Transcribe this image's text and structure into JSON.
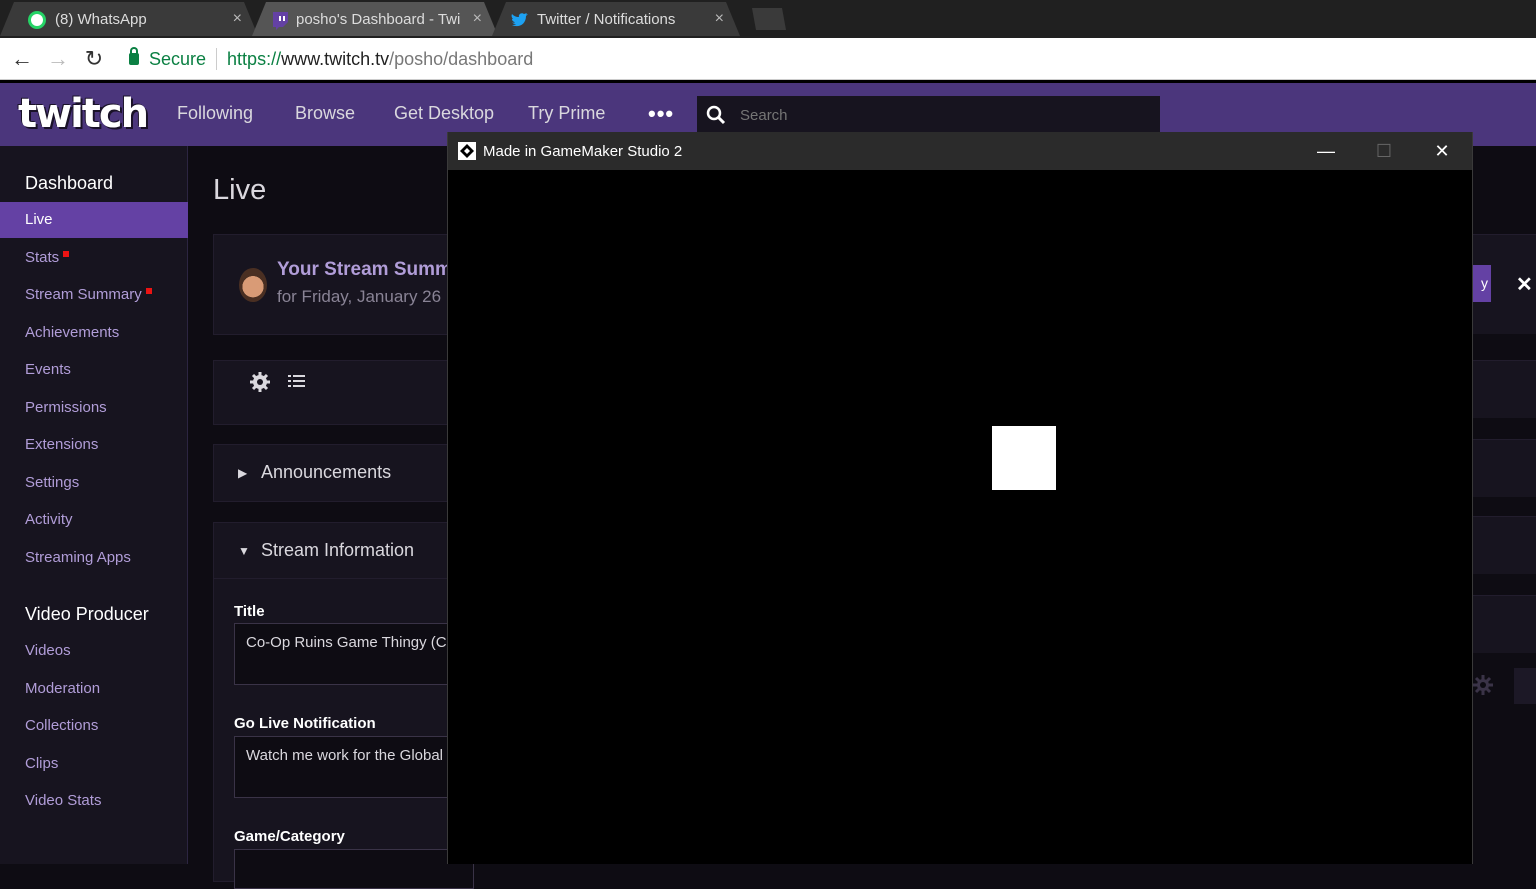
{
  "browser": {
    "tabs": [
      {
        "title": "(8) WhatsApp",
        "badge": "8"
      },
      {
        "title": "posho's Dashboard - Twi"
      },
      {
        "title": "Twitter / Notifications"
      }
    ],
    "close_glyph": "×",
    "secure_label": "Secure",
    "url": {
      "scheme": "https://",
      "host": "www.twitch.tv",
      "path": "/posho/dashboard"
    }
  },
  "twitch_nav": {
    "logo_text": "twitch",
    "items": [
      "Following",
      "Browse",
      "Get Desktop",
      "Try Prime"
    ],
    "more": "•••",
    "search_placeholder": "Search"
  },
  "sidebar": {
    "dashboard_heading": "Dashboard",
    "dashboard_items": [
      {
        "label": "Live",
        "active": true
      },
      {
        "label": "Stats",
        "dot": true
      },
      {
        "label": "Stream Summary",
        "dot": true
      },
      {
        "label": "Achievements"
      },
      {
        "label": "Events"
      },
      {
        "label": "Permissions"
      },
      {
        "label": "Extensions"
      },
      {
        "label": "Settings"
      },
      {
        "label": "Activity"
      },
      {
        "label": "Streaming Apps"
      }
    ],
    "producer_heading": "Video Producer",
    "producer_items": [
      {
        "label": "Videos"
      },
      {
        "label": "Moderation"
      },
      {
        "label": "Collections"
      },
      {
        "label": "Clips"
      },
      {
        "label": "Video Stats"
      }
    ]
  },
  "main": {
    "page_title": "Live",
    "summary": {
      "title": "Your Stream Summ",
      "subtitle": "for Friday, January 26"
    },
    "announcements": "Announcements",
    "stream_info": "Stream Information",
    "title_label": "Title",
    "title_value": "Co-Op Ruins Game Thingy (C",
    "golive_label": "Go Live Notification",
    "golive_value": "Watch me work for the Global",
    "game_label": "Game/Category",
    "summary_btn_fragment": "y",
    "close_glyph": "✕"
  },
  "gamemaker": {
    "title": "Made in GameMaker Studio 2",
    "minimize": "—",
    "maximize": "☐",
    "close": "✕"
  },
  "colors": {
    "twitch_purple": "#6441a4",
    "nav_bg": "#4b367c",
    "sidebar_bg": "#17141f"
  }
}
